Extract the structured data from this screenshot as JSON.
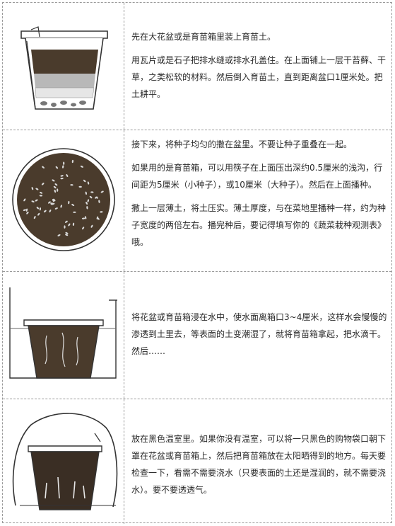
{
  "steps": [
    {
      "illustration": "pot-with-drainage-layer",
      "paragraphs": [
        "先在大花盆或是育苗箱里装上育苗土。",
        "用瓦片或是石子把排水缝或排水孔盖住。在上面铺上一层干苔藓、干草，之类松软的材料。然后倒入育苗土，直到距离盆口1厘米处。把土耕平。"
      ]
    },
    {
      "illustration": "seeds-in-tray-top-view",
      "paragraphs": [
        "接下来，将种子均匀的撒在盆里。不要让种子重叠在一起。",
        "如果用的是育苗箱，可以用筷子在上面压出深约0.5厘米的浅沟，行间距为5厘米（小种子），或10厘米（大种子）。然后在上面播种。",
        "撒上一层薄土，将土压实。薄土厚度，与在菜地里播种一样，约为种子宽度的两倍左右。播完种后，要记得填写你的《蔬菜栽种观测表》哦。"
      ]
    },
    {
      "illustration": "pot-soaking-in-water",
      "paragraphs": [
        "将花盆或育苗箱浸在水中，使水面离箱口3~4厘米，这样水会慢慢的渗透到土里去，等表面的土变潮湿了，就将育苗箱拿起，把水滴干。然后……"
      ]
    },
    {
      "illustration": "pot-covered-with-black-bag",
      "paragraphs": [
        "放在黑色温室里。如果你没有温室，可以将一只黑色的购物袋口朝下罩在花盆或育苗箱上，然后把育苗箱放在太阳晒得到的地方。每天要检查一下，看需不需要浇水（只要表面的土还是湿润的，就不需要浇水）。要不要透透气。"
      ]
    }
  ]
}
